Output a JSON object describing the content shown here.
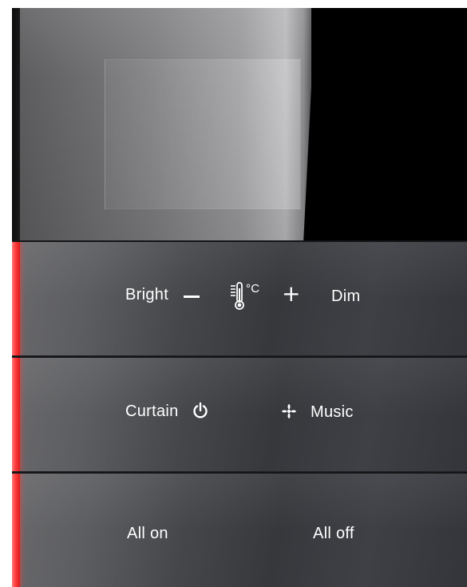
{
  "panel": {
    "row1": {
      "bright_label": "Bright",
      "minus_icon": "minus-icon",
      "thermometer_icon": "thermometer-celsius-icon",
      "celsius_label": "°C",
      "plus_label": "+",
      "dim_label": "Dim"
    },
    "row2": {
      "curtain_label": "Curtain",
      "power_icon": "power-icon",
      "fan_icon": "fan-icon",
      "music_label": "Music"
    },
    "row3": {
      "all_on_label": "All on",
      "all_off_label": "All off"
    },
    "colors": {
      "led_indicator": "#ff3b3b",
      "panel_dark": "#1f2023",
      "text": "#ffffff"
    }
  }
}
